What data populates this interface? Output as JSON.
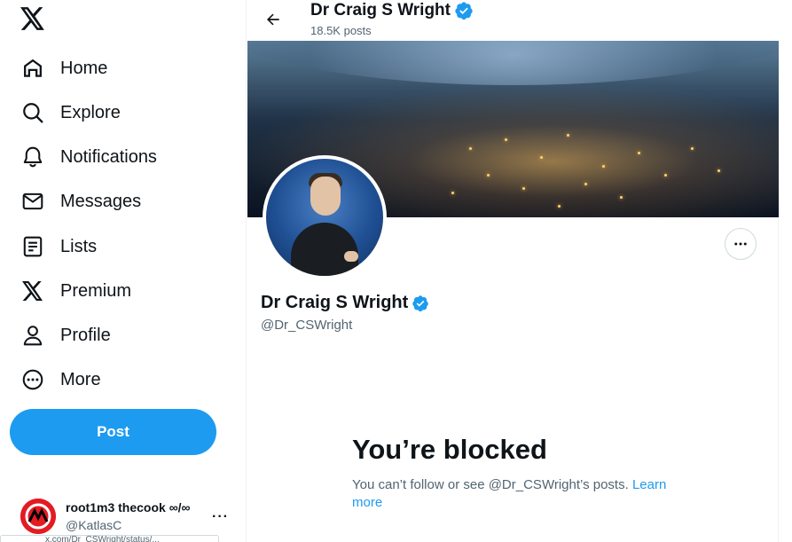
{
  "nav": {
    "items": [
      {
        "label": "Home",
        "icon": "home-icon"
      },
      {
        "label": "Explore",
        "icon": "search-icon"
      },
      {
        "label": "Notifications",
        "icon": "bell-icon"
      },
      {
        "label": "Messages",
        "icon": "mail-icon"
      },
      {
        "label": "Lists",
        "icon": "list-icon"
      },
      {
        "label": "Premium",
        "icon": "x-logo-icon"
      },
      {
        "label": "Profile",
        "icon": "person-icon"
      },
      {
        "label": "More",
        "icon": "more-circle-icon"
      }
    ],
    "post_label": "Post"
  },
  "account": {
    "name": "root1m3 thecook ∞/∞",
    "handle": "@KatlasC",
    "more": "···"
  },
  "tooltip_text": "x.com/Dr_CSWright/status/...",
  "header": {
    "name": "Dr Craig S Wright",
    "posts": "18.5K posts"
  },
  "profile": {
    "name": "Dr Craig S Wright",
    "handle": "@Dr_CSWright",
    "verified": true
  },
  "blocked": {
    "title": "You’re blocked",
    "message": "You can’t follow or see @Dr_CSWright’s posts. ",
    "learn_more": "Learn more"
  },
  "colors": {
    "accent": "#1d9bf0",
    "text": "#0f1419",
    "muted": "#536471"
  }
}
